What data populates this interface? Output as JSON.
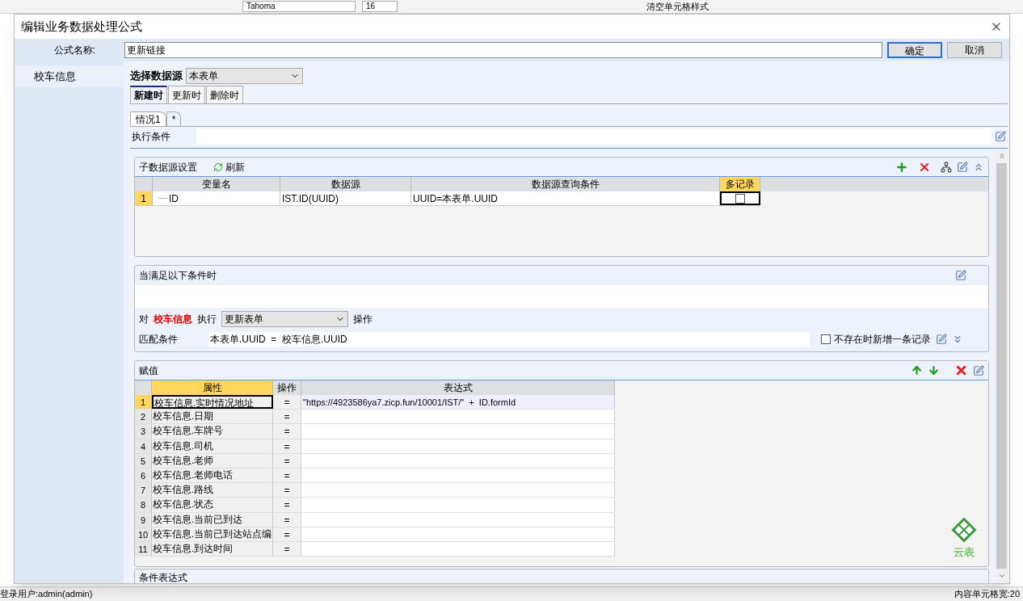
{
  "host": {
    "toolbar": {
      "font": "Tahoma",
      "size": "16",
      "clear_format": "清空单元格样式"
    },
    "status_bar": {
      "user": "登录用户:admin(admin)",
      "cell_width": "内容单元格宽:20"
    }
  },
  "dialog": {
    "title": "编辑业务数据处理公式",
    "name_label": "公式名称:",
    "name_value": "更新链接",
    "buttons": [
      {
        "label": "确定",
        "default": true
      },
      {
        "label": "取消",
        "default": false
      }
    ],
    "sidebar": [
      {
        "label": "校车信息",
        "selected": true
      }
    ],
    "source_label": "选择数据源",
    "source_value": "本表单",
    "tabs": [
      {
        "label": "新建时",
        "selected": true
      },
      {
        "label": "更新时",
        "selected": false
      },
      {
        "label": "删除时",
        "selected": false
      }
    ],
    "cases": [
      {
        "label": "情况1",
        "selected": true
      },
      {
        "label": "*",
        "selected": false
      }
    ],
    "condition_label": "执行条件",
    "sub_sources": {
      "title": "子数据源设置",
      "refresh": "刷新",
      "columns": [
        {
          "label": "变量名",
          "selected": false
        },
        {
          "label": "数据源",
          "selected": false
        },
        {
          "label": "数据源查询条件",
          "selected": false
        },
        {
          "label": "多记录",
          "selected": true
        }
      ],
      "rows": [
        {
          "num": "1",
          "name": "ID",
          "source": "IST.ID(UUID)",
          "query": "UUID=本表单.UUID",
          "multi": false,
          "selected": true
        }
      ]
    },
    "when": {
      "title": "当满足以下条件时",
      "for_label": "对",
      "target": "校车信息",
      "exec_label": "执行",
      "action": "更新表单",
      "op_label": "操作",
      "match_label": "匹配条件",
      "match_value": "本表单.UUID  =  校车信息.UUID",
      "insert_missing": {
        "label": "不存在时新增一条记录",
        "checked": false
      }
    },
    "assign": {
      "title": "赋值",
      "columns": [
        {
          "label": "属性",
          "selected": true
        },
        {
          "label": "操作",
          "selected": false
        },
        {
          "label": "表达式",
          "selected": false
        }
      ],
      "rows": [
        {
          "num": "1",
          "property": "校车信息.实时情况地址",
          "op": "=",
          "expr": "\"https://4923586ya7.zicp.fun/10001/IST/\"  +  ID.formId",
          "selected": true
        },
        {
          "num": "2",
          "property": "校车信息.日期",
          "op": "=",
          "selected": false
        },
        {
          "num": "3",
          "property": "校车信息.车牌号",
          "op": "=",
          "selected": false
        },
        {
          "num": "4",
          "property": "校车信息.司机",
          "op": "=",
          "selected": false
        },
        {
          "num": "5",
          "property": "校车信息.老师",
          "op": "=",
          "selected": false
        },
        {
          "num": "6",
          "property": "校车信息.老师电话",
          "op": "=",
          "selected": false
        },
        {
          "num": "7",
          "property": "校车信息.路线",
          "op": "=",
          "selected": false
        },
        {
          "num": "8",
          "property": "校车信息.状态",
          "op": "=",
          "selected": false
        },
        {
          "num": "9",
          "property": "校车信息.当前已到达",
          "op": "=",
          "selected": false
        },
        {
          "num": "10",
          "property": "校车信息.当前已到达站点编",
          "op": "=",
          "selected": false
        },
        {
          "num": "11",
          "property": "校车信息.到达时间",
          "op": "=",
          "selected": false
        }
      ]
    },
    "logo_text": "云表",
    "next_panel": {
      "title": "条件表达式"
    }
  }
}
